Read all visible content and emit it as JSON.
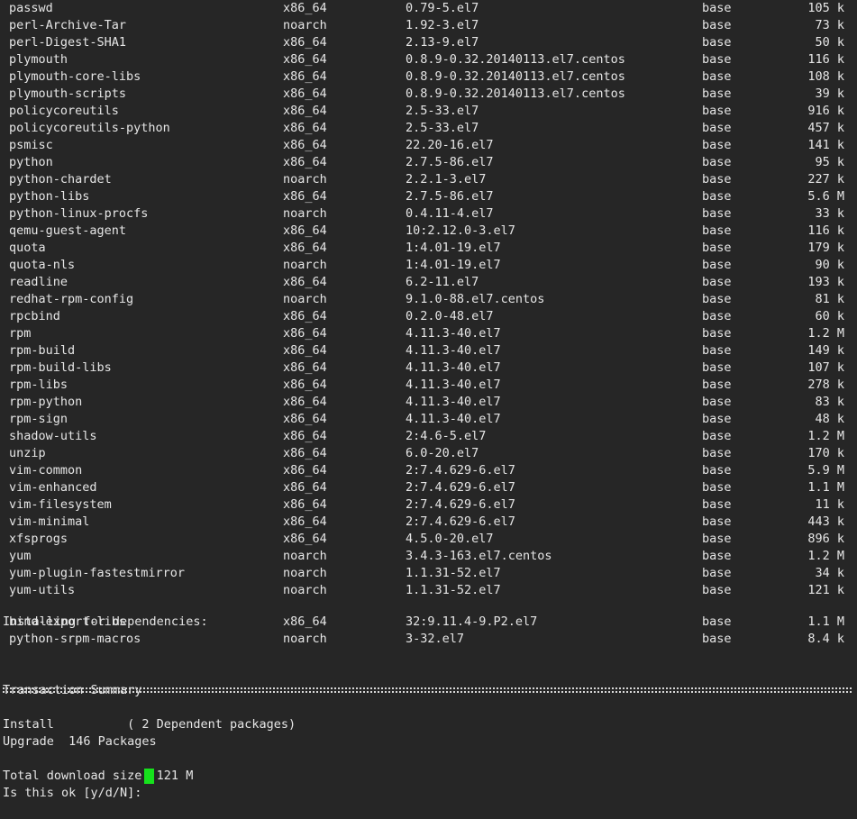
{
  "packages": [
    {
      "name": "passwd",
      "arch": "x86_64",
      "version": "0.79-5.el7",
      "repo": "base",
      "size": "105 k"
    },
    {
      "name": "perl-Archive-Tar",
      "arch": "noarch",
      "version": "1.92-3.el7",
      "repo": "base",
      "size": "73 k"
    },
    {
      "name": "perl-Digest-SHA1",
      "arch": "x86_64",
      "version": "2.13-9.el7",
      "repo": "base",
      "size": "50 k"
    },
    {
      "name": "plymouth",
      "arch": "x86_64",
      "version": "0.8.9-0.32.20140113.el7.centos",
      "repo": "base",
      "size": "116 k"
    },
    {
      "name": "plymouth-core-libs",
      "arch": "x86_64",
      "version": "0.8.9-0.32.20140113.el7.centos",
      "repo": "base",
      "size": "108 k"
    },
    {
      "name": "plymouth-scripts",
      "arch": "x86_64",
      "version": "0.8.9-0.32.20140113.el7.centos",
      "repo": "base",
      "size": "39 k"
    },
    {
      "name": "policycoreutils",
      "arch": "x86_64",
      "version": "2.5-33.el7",
      "repo": "base",
      "size": "916 k"
    },
    {
      "name": "policycoreutils-python",
      "arch": "x86_64",
      "version": "2.5-33.el7",
      "repo": "base",
      "size": "457 k"
    },
    {
      "name": "psmisc",
      "arch": "x86_64",
      "version": "22.20-16.el7",
      "repo": "base",
      "size": "141 k"
    },
    {
      "name": "python",
      "arch": "x86_64",
      "version": "2.7.5-86.el7",
      "repo": "base",
      "size": "95 k"
    },
    {
      "name": "python-chardet",
      "arch": "noarch",
      "version": "2.2.1-3.el7",
      "repo": "base",
      "size": "227 k"
    },
    {
      "name": "python-libs",
      "arch": "x86_64",
      "version": "2.7.5-86.el7",
      "repo": "base",
      "size": "5.6 M"
    },
    {
      "name": "python-linux-procfs",
      "arch": "noarch",
      "version": "0.4.11-4.el7",
      "repo": "base",
      "size": "33 k"
    },
    {
      "name": "qemu-guest-agent",
      "arch": "x86_64",
      "version": "10:2.12.0-3.el7",
      "repo": "base",
      "size": "116 k"
    },
    {
      "name": "quota",
      "arch": "x86_64",
      "version": "1:4.01-19.el7",
      "repo": "base",
      "size": "179 k"
    },
    {
      "name": "quota-nls",
      "arch": "noarch",
      "version": "1:4.01-19.el7",
      "repo": "base",
      "size": "90 k"
    },
    {
      "name": "readline",
      "arch": "x86_64",
      "version": "6.2-11.el7",
      "repo": "base",
      "size": "193 k"
    },
    {
      "name": "redhat-rpm-config",
      "arch": "noarch",
      "version": "9.1.0-88.el7.centos",
      "repo": "base",
      "size": "81 k"
    },
    {
      "name": "rpcbind",
      "arch": "x86_64",
      "version": "0.2.0-48.el7",
      "repo": "base",
      "size": "60 k"
    },
    {
      "name": "rpm",
      "arch": "x86_64",
      "version": "4.11.3-40.el7",
      "repo": "base",
      "size": "1.2 M"
    },
    {
      "name": "rpm-build",
      "arch": "x86_64",
      "version": "4.11.3-40.el7",
      "repo": "base",
      "size": "149 k"
    },
    {
      "name": "rpm-build-libs",
      "arch": "x86_64",
      "version": "4.11.3-40.el7",
      "repo": "base",
      "size": "107 k"
    },
    {
      "name": "rpm-libs",
      "arch": "x86_64",
      "version": "4.11.3-40.el7",
      "repo": "base",
      "size": "278 k"
    },
    {
      "name": "rpm-python",
      "arch": "x86_64",
      "version": "4.11.3-40.el7",
      "repo": "base",
      "size": "83 k"
    },
    {
      "name": "rpm-sign",
      "arch": "x86_64",
      "version": "4.11.3-40.el7",
      "repo": "base",
      "size": "48 k"
    },
    {
      "name": "shadow-utils",
      "arch": "x86_64",
      "version": "2:4.6-5.el7",
      "repo": "base",
      "size": "1.2 M"
    },
    {
      "name": "unzip",
      "arch": "x86_64",
      "version": "6.0-20.el7",
      "repo": "base",
      "size": "170 k"
    },
    {
      "name": "vim-common",
      "arch": "x86_64",
      "version": "2:7.4.629-6.el7",
      "repo": "base",
      "size": "5.9 M"
    },
    {
      "name": "vim-enhanced",
      "arch": "x86_64",
      "version": "2:7.4.629-6.el7",
      "repo": "base",
      "size": "1.1 M"
    },
    {
      "name": "vim-filesystem",
      "arch": "x86_64",
      "version": "2:7.4.629-6.el7",
      "repo": "base",
      "size": "11 k"
    },
    {
      "name": "vim-minimal",
      "arch": "x86_64",
      "version": "2:7.4.629-6.el7",
      "repo": "base",
      "size": "443 k"
    },
    {
      "name": "xfsprogs",
      "arch": "x86_64",
      "version": "4.5.0-20.el7",
      "repo": "base",
      "size": "896 k"
    },
    {
      "name": "yum",
      "arch": "noarch",
      "version": "3.4.3-163.el7.centos",
      "repo": "base",
      "size": "1.2 M"
    },
    {
      "name": "yum-plugin-fastestmirror",
      "arch": "noarch",
      "version": "1.1.31-52.el7",
      "repo": "base",
      "size": "34 k"
    },
    {
      "name": "yum-utils",
      "arch": "noarch",
      "version": "1.1.31-52.el7",
      "repo": "base",
      "size": "121 k"
    }
  ],
  "deps_header": "Installing for dependencies:",
  "dependencies": [
    {
      "name": "bind-export-libs",
      "arch": "x86_64",
      "version": "32:9.11.4-9.P2.el7",
      "repo": "base",
      "size": "1.1 M"
    },
    {
      "name": "python-srpm-macros",
      "arch": "noarch",
      "version": "3-32.el7",
      "repo": "base",
      "size": "8.4 k"
    }
  ],
  "summary": {
    "title": "Transaction Summary",
    "install_line": "Install          ( 2 Dependent packages)",
    "upgrade_line": "Upgrade  146 Packages",
    "download_line": "Total download size: 121 M",
    "prompt": "Is this ok [y/d/N]:"
  },
  "colors": {
    "background": "#262626",
    "text": "#e6e6e6",
    "cursor": "#16e11c"
  }
}
